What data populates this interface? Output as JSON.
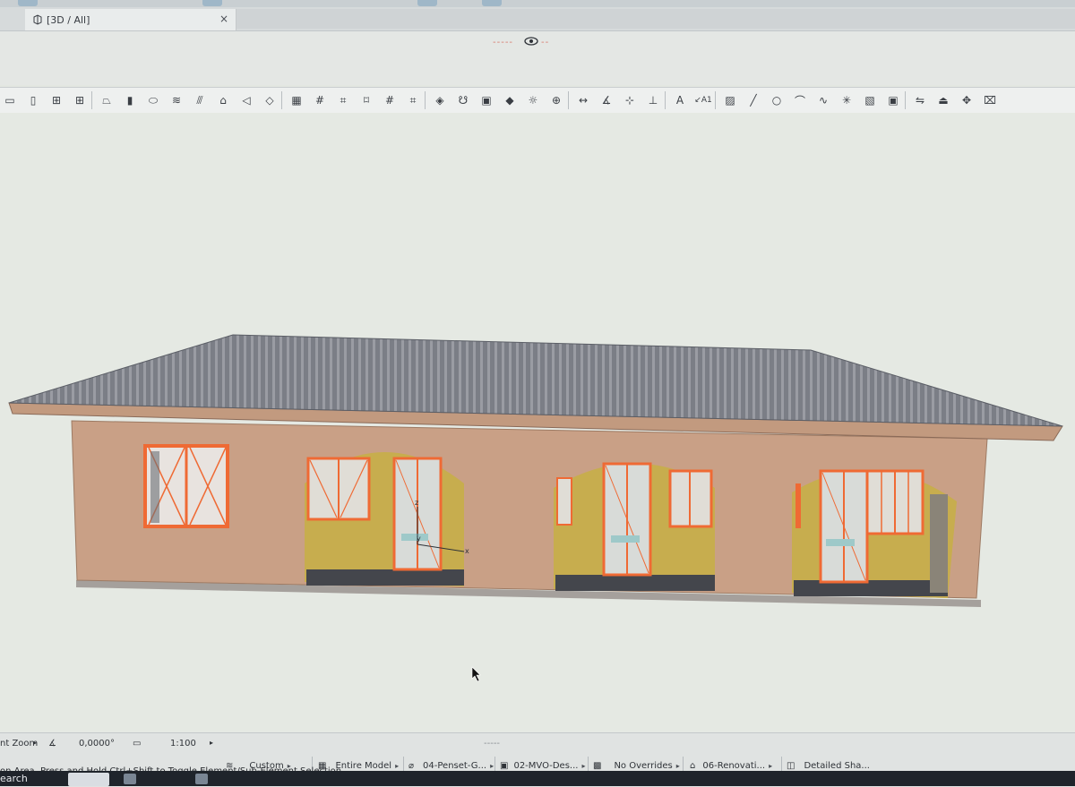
{
  "window": {
    "tab_title": "[3D / All]",
    "tab_close": "×"
  },
  "toolbar": {
    "tools": [
      {
        "name": "wall-icon",
        "glyph": "▭"
      },
      {
        "name": "door-icon",
        "glyph": "▯"
      },
      {
        "name": "window-icon",
        "glyph": "⊞"
      },
      {
        "name": "curtain-wall-icon",
        "glyph": "⊞"
      },
      {
        "name": "beam-icon",
        "glyph": "⏢"
      },
      {
        "name": "column-icon",
        "glyph": "▮"
      },
      {
        "name": "slab-icon",
        "glyph": "⬭"
      },
      {
        "name": "stair-icon",
        "glyph": "≋"
      },
      {
        "name": "railing-icon",
        "glyph": "⫻"
      },
      {
        "name": "roof-icon",
        "glyph": "⌂"
      },
      {
        "name": "shell-icon",
        "glyph": "◁"
      },
      {
        "name": "skylight-icon",
        "glyph": "◇"
      },
      {
        "name": "mesh-icon",
        "glyph": "▦"
      },
      {
        "name": "grid-icon",
        "glyph": "#"
      },
      {
        "name": "grid-element-icon",
        "glyph": "⌗"
      },
      {
        "name": "zone-icon",
        "glyph": "⌑"
      },
      {
        "name": "column-grid-icon",
        "glyph": "#"
      },
      {
        "name": "hatch-grid-icon",
        "glyph": "⌗"
      },
      {
        "name": "object-icon",
        "glyph": "◈"
      },
      {
        "name": "lamp-icon",
        "glyph": "☋"
      },
      {
        "name": "equipment-icon",
        "glyph": "▣"
      },
      {
        "name": "morph-icon",
        "glyph": "◆"
      },
      {
        "name": "light-icon",
        "glyph": "☼"
      },
      {
        "name": "radial-dimension-icon",
        "glyph": "⊕"
      },
      {
        "name": "linear-dimension-icon",
        "glyph": "↔"
      },
      {
        "name": "angle-dimension-icon",
        "glyph": "∡"
      },
      {
        "name": "level-dimension-icon",
        "glyph": "⊹"
      },
      {
        "name": "elevation-dimension-icon",
        "glyph": "⊥"
      },
      {
        "name": "text-icon",
        "glyph": "A"
      },
      {
        "name": "label-icon",
        "glyph": "↙A1"
      },
      {
        "name": "fill-icon",
        "glyph": "▨"
      },
      {
        "name": "line-icon",
        "glyph": "╱"
      },
      {
        "name": "circle-icon",
        "glyph": "○"
      },
      {
        "name": "arc-icon",
        "glyph": "⌒"
      },
      {
        "name": "spline-icon",
        "glyph": "∿"
      },
      {
        "name": "hotspot-icon",
        "glyph": "✳"
      },
      {
        "name": "figure-icon",
        "glyph": "▧"
      },
      {
        "name": "camera-icon",
        "glyph": "▣"
      },
      {
        "name": "section-icon",
        "glyph": "⇋"
      },
      {
        "name": "elevation-marker-icon",
        "glyph": "⏏"
      },
      {
        "name": "change-marker-icon",
        "glyph": "✥"
      },
      {
        "name": "detail-icon",
        "glyph": "⌧"
      }
    ]
  },
  "status": {
    "zoom_label": "nt Zoom",
    "angle": "0,0000°",
    "scale": "1:100",
    "pen_set_mode": "Custom",
    "model_filter": "Entire Model",
    "pen_set": "04-Penset-G...",
    "model_view": "02-MVO-Des...",
    "overrides": "No Overrides",
    "renovation": "06-Renovati...",
    "structure": "Detailed Sha...",
    "hint": "on Area. Press and Hold Ctrl+Shift to Toggle Element/Sub-Element Selection."
  },
  "taskbar": {
    "search": "earch"
  },
  "model": {
    "axis_x": "x",
    "axis_y": "y",
    "axis_z": "z"
  },
  "colors": {
    "wall": "#c9a086",
    "roof": "#7a7d84",
    "interior_wall": "#c7ad4e",
    "window_frame": "#f0652e",
    "floor": "#44464c"
  }
}
